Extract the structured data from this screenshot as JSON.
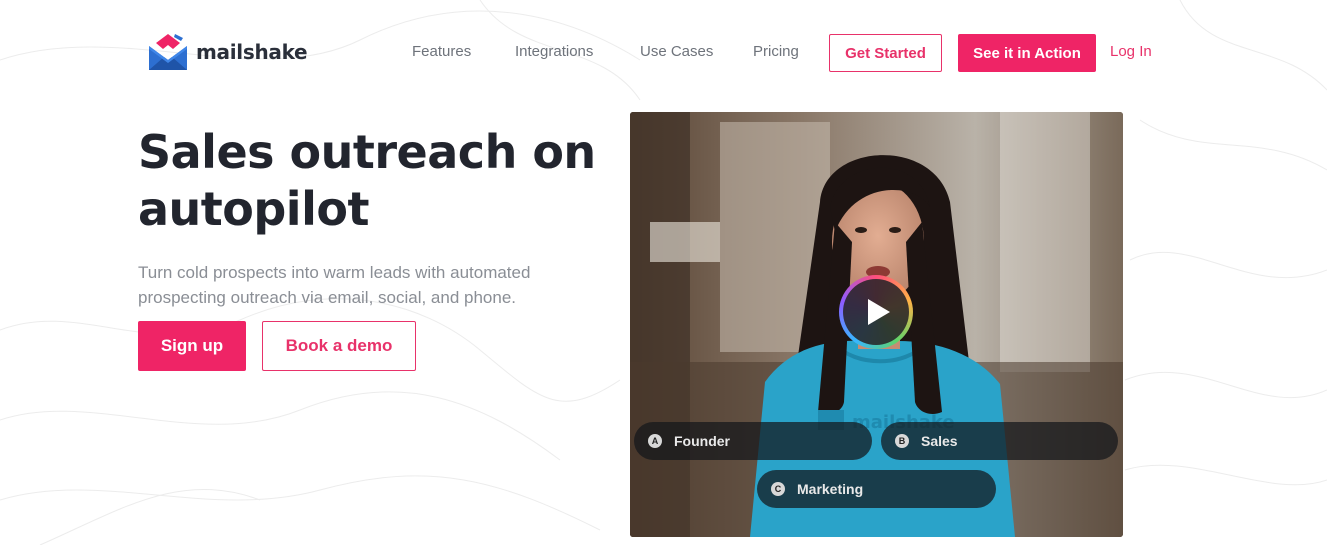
{
  "brand": {
    "name": "mailshake",
    "accent": "#ef2466"
  },
  "nav": {
    "links": [
      "Features",
      "Integrations",
      "Use Cases",
      "Pricing"
    ],
    "get_started": "Get Started",
    "see_action": "See it in Action",
    "login": "Log In"
  },
  "hero": {
    "headline_line1": "Sales outreach on",
    "headline_line2": "autopilot",
    "subtext": "Turn cold prospects into warm leads with automated prospecting outreach via email, social, and phone.",
    "signup": "Sign up",
    "book_demo": "Book a demo"
  },
  "video": {
    "shirt_logo": "mailshake",
    "choices": [
      {
        "key": "A",
        "label": "Founder"
      },
      {
        "key": "B",
        "label": "Sales"
      },
      {
        "key": "C",
        "label": "Marketing"
      }
    ]
  }
}
